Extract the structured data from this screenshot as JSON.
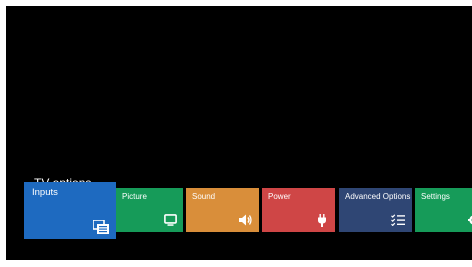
{
  "menu": {
    "title": "TV options"
  },
  "tiles": [
    {
      "id": "inputs",
      "label": "Inputs",
      "color": "#1e6ac0",
      "icon": "inputs-icon",
      "focused": true
    },
    {
      "id": "picture",
      "label": "Picture",
      "color": "#169b59",
      "icon": "monitor-icon",
      "focused": false
    },
    {
      "id": "sound",
      "label": "Sound",
      "color": "#d98e3a",
      "icon": "speaker-icon",
      "focused": false
    },
    {
      "id": "power",
      "label": "Power",
      "color": "#cf4646",
      "icon": "power-plug-icon",
      "focused": false
    },
    {
      "id": "advanced",
      "label": "Advanced Options",
      "color": "#2f4674",
      "icon": "checklist-icon",
      "focused": false
    },
    {
      "id": "settings",
      "label": "Settings",
      "color": "#169b59",
      "icon": "gear-icon",
      "focused": false
    }
  ]
}
